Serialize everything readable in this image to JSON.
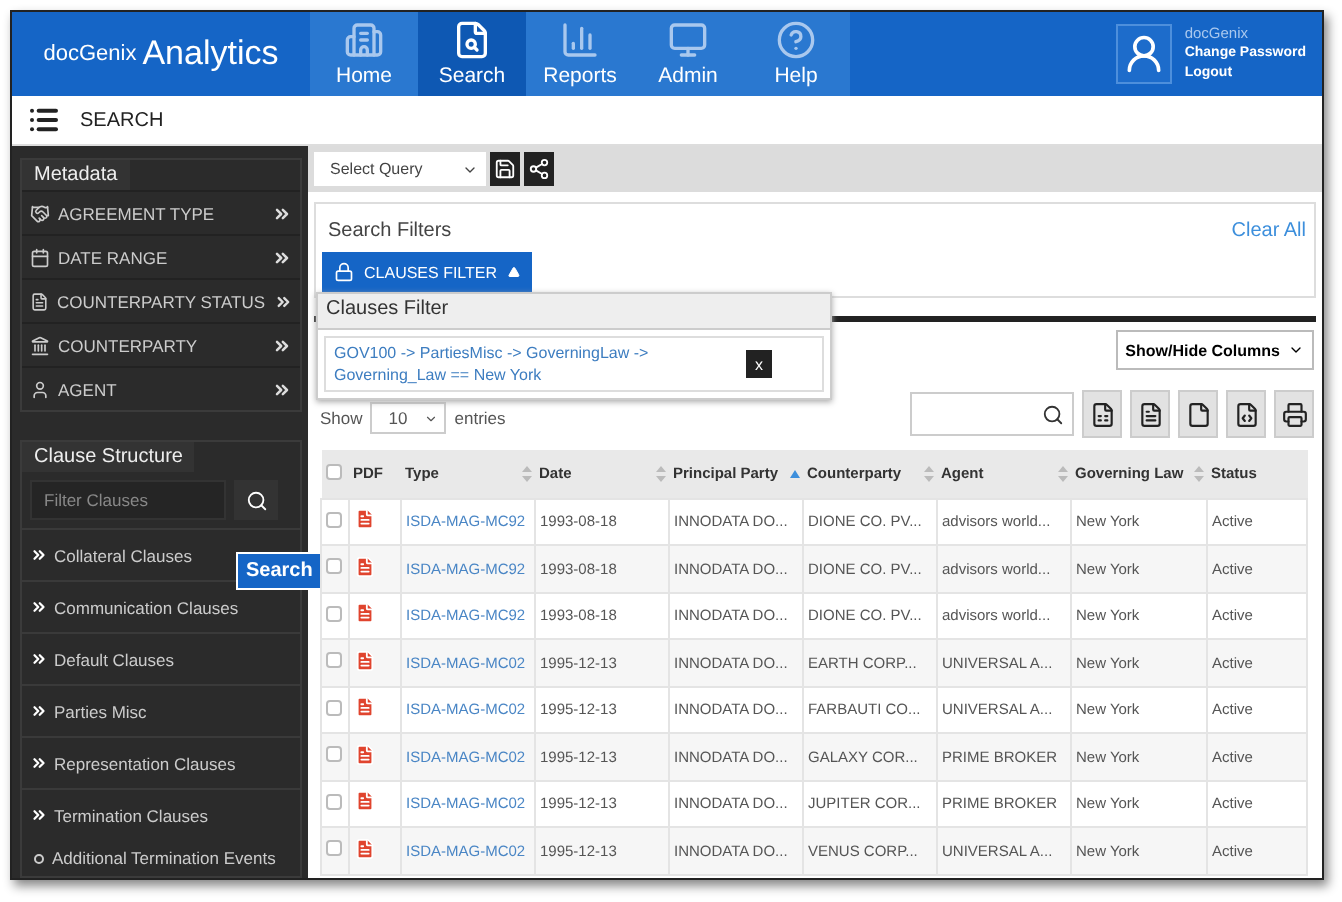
{
  "header": {
    "brand_prefix": "docGenix",
    "brand": "Analytics",
    "nav": [
      {
        "label": "Home",
        "selected": false
      },
      {
        "label": "Search",
        "selected": true
      },
      {
        "label": "Reports",
        "selected": false
      },
      {
        "label": "Admin",
        "selected": false
      },
      {
        "label": "Help",
        "selected": false
      }
    ],
    "user": {
      "name": "docGenix",
      "links": [
        "Change Password",
        "Logout"
      ]
    }
  },
  "subheader": {
    "title": "SEARCH"
  },
  "sidebar": {
    "metadata_title": "Metadata",
    "metadata_items": [
      "AGREEMENT TYPE",
      "DATE RANGE",
      "COUNTERPARTY STATUS",
      "COUNTERPARTY",
      "AGENT"
    ],
    "clause_title": "Clause Structure",
    "filter_placeholder": "Filter Clauses",
    "clauses": [
      {
        "label": "Collateral Clauses"
      },
      {
        "label": "Communication Clauses"
      },
      {
        "label": "Default Clauses"
      },
      {
        "label": "Parties Misc"
      },
      {
        "label": "Representation Clauses"
      },
      {
        "label": "Termination Clauses",
        "children": [
          {
            "label": "Additional Termination Events"
          }
        ]
      }
    ],
    "tooltip": "Search"
  },
  "query": {
    "placeholder": "Select Query"
  },
  "filters": {
    "title": "Search Filters",
    "clear": "Clear All",
    "button": "CLAUSES FILTER",
    "popup": {
      "title": "Clauses Filter",
      "text": "GOV100 -> PartiesMisc -> GoverningLaw -> Governing_Law == New York",
      "close": "x"
    }
  },
  "table_tools": {
    "show_hide": "Show/Hide Columns",
    "show": "Show",
    "page_size": "10",
    "entries": "entries"
  },
  "table": {
    "select_all_checked": false,
    "pdf_header": "PDF",
    "columns": [
      {
        "label": "Type",
        "kind": "link",
        "sortable": true,
        "sorted": false
      },
      {
        "label": "Date",
        "kind": "text",
        "sortable": true,
        "sorted": false
      },
      {
        "label": "Principal Party",
        "kind": "text",
        "sortable": true,
        "sorted": true
      },
      {
        "label": "Counterparty",
        "kind": "text",
        "sortable": true,
        "sorted": false
      },
      {
        "label": "Agent",
        "kind": "text",
        "sortable": true,
        "sorted": false
      },
      {
        "label": "Governing Law",
        "kind": "text",
        "sortable": true,
        "sorted": false
      },
      {
        "label": "Status",
        "kind": "text",
        "sortable": false,
        "sorted": false
      }
    ],
    "rows": [
      {
        "checked": false,
        "cells": [
          "ISDA-MAG-MC92",
          "1993-08-18",
          "INNODATA DO...",
          "DIONE CO. PV...",
          "advisors world...",
          "New York",
          "Active"
        ]
      },
      {
        "checked": false,
        "cells": [
          "ISDA-MAG-MC92",
          "1993-08-18",
          "INNODATA DO...",
          "DIONE CO. PV...",
          "advisors world...",
          "New York",
          "Active"
        ]
      },
      {
        "checked": false,
        "cells": [
          "ISDA-MAG-MC92",
          "1993-08-18",
          "INNODATA DO...",
          "DIONE CO. PV...",
          "advisors world...",
          "New York",
          "Active"
        ]
      },
      {
        "checked": false,
        "cells": [
          "ISDA-MAG-MC02",
          "1995-12-13",
          "INNODATA DO...",
          "EARTH CORP...",
          "UNIVERSAL A...",
          "New York",
          "Active"
        ]
      },
      {
        "checked": false,
        "cells": [
          "ISDA-MAG-MC02",
          "1995-12-13",
          "INNODATA DO...",
          "FARBAUTI CO...",
          "UNIVERSAL A...",
          "New York",
          "Active"
        ]
      },
      {
        "checked": false,
        "cells": [
          "ISDA-MAG-MC02",
          "1995-12-13",
          "INNODATA DO...",
          "GALAXY COR...",
          "PRIME BROKER",
          "New York",
          "Active"
        ]
      },
      {
        "checked": false,
        "cells": [
          "ISDA-MAG-MC02",
          "1995-12-13",
          "INNODATA DO...",
          "JUPITER COR...",
          "PRIME BROKER",
          "New York",
          "Active"
        ]
      },
      {
        "checked": false,
        "cells": [
          "ISDA-MAG-MC02",
          "1995-12-13",
          "INNODATA DO...",
          "VENUS CORP...",
          "UNIVERSAL A...",
          "New York",
          "Active"
        ]
      }
    ]
  }
}
